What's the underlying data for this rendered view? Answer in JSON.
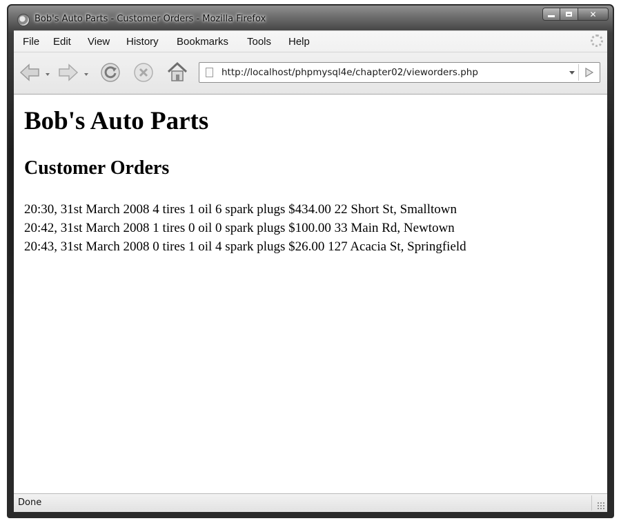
{
  "window": {
    "title": "Bob's Auto Parts - Customer Orders - Mozilla Firefox"
  },
  "menu": {
    "items": [
      "File",
      "Edit",
      "View",
      "History",
      "Bookmarks",
      "Tools",
      "Help"
    ]
  },
  "toolbar": {
    "url": "http://localhost/phpmysql4e/chapter02/vieworders.php"
  },
  "page": {
    "heading": "Bob's Auto Parts",
    "subheading": "Customer Orders",
    "orders": [
      "20:30, 31st March 2008 4 tires 1 oil 6 spark plugs $434.00 22 Short St, Smalltown",
      "20:42, 31st March 2008 1 tires 0 oil 0 spark plugs $100.00 33 Main Rd, Newtown",
      "20:43, 31st March 2008 0 tires 1 oil 4 spark plugs $26.00 127 Acacia St, Springfield"
    ]
  },
  "status": {
    "text": "Done"
  }
}
